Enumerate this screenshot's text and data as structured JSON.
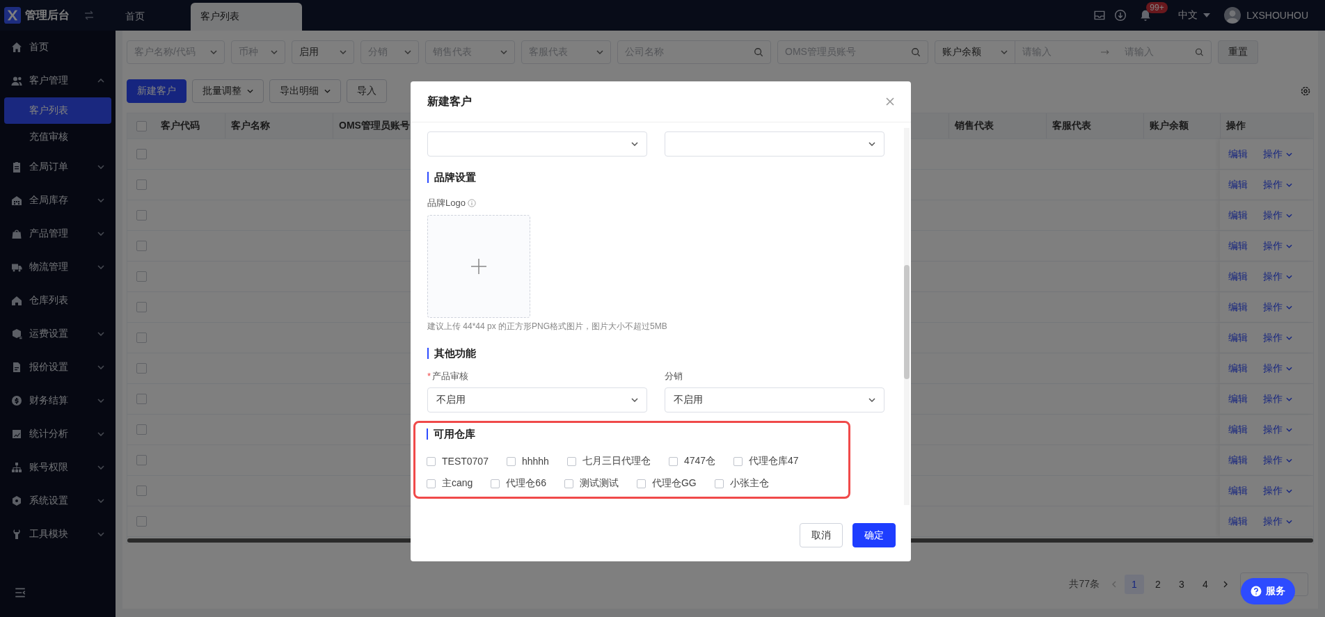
{
  "app": {
    "title": "管理后台"
  },
  "tabs": [
    {
      "label": "首页",
      "selected": false
    },
    {
      "label": "客户列表",
      "selected": true
    }
  ],
  "header": {
    "badge": "99+",
    "language": "中文",
    "user": "LXSHOUHOU"
  },
  "sidebar": {
    "items": [
      {
        "label": "首页"
      },
      {
        "label": "客户管理",
        "expanded": true,
        "children": [
          {
            "label": "客户列表",
            "selected": true
          },
          {
            "label": "充值审核",
            "selected": false
          }
        ]
      },
      {
        "label": "全局订单",
        "expanded": false
      },
      {
        "label": "全局库存",
        "expanded": false
      },
      {
        "label": "产品管理",
        "expanded": false
      },
      {
        "label": "物流管理",
        "expanded": false
      },
      {
        "label": "仓库列表"
      },
      {
        "label": "运费设置",
        "expanded": false
      },
      {
        "label": "报价设置",
        "expanded": false
      },
      {
        "label": "财务结算",
        "expanded": false
      },
      {
        "label": "统计分析",
        "expanded": false
      },
      {
        "label": "账号权限",
        "expanded": false
      },
      {
        "label": "系统设置",
        "expanded": false
      },
      {
        "label": "工具模块",
        "expanded": false
      }
    ]
  },
  "filters": [
    {
      "kind": "select",
      "placeholder": "客户名称/代码"
    },
    {
      "kind": "select",
      "placeholder": "币种"
    },
    {
      "kind": "select",
      "value": "启用"
    },
    {
      "kind": "select",
      "placeholder": "分销"
    },
    {
      "kind": "select",
      "placeholder": "销售代表"
    },
    {
      "kind": "select",
      "placeholder": "客服代表"
    },
    {
      "kind": "search",
      "placeholder": "公司名称"
    },
    {
      "kind": "search",
      "placeholder": "OMS管理员账号"
    },
    {
      "kind": "range",
      "value": "账户余额",
      "from_placeholder": "请输入",
      "to_placeholder": "请输入"
    }
  ],
  "reset_button": "重置",
  "toolbar": [
    {
      "label": "新建客户",
      "kind": "primary"
    },
    {
      "label": "批量调整",
      "kind": "dropdown"
    },
    {
      "label": "导出明细",
      "kind": "dropdown"
    },
    {
      "label": "导入",
      "kind": "plain"
    }
  ],
  "table": {
    "columns_left": [
      "客户代码",
      "客户名称",
      "OMS管理员账号"
    ],
    "columns_right": [
      "销售代表",
      "客服代表",
      "账户余额",
      "操作"
    ],
    "all_checked": false,
    "rows": [
      {
        "checked": false,
        "edit": "编辑",
        "more": "操作"
      },
      {
        "checked": false,
        "edit": "编辑",
        "more": "操作"
      },
      {
        "checked": false,
        "edit": "编辑",
        "more": "操作"
      },
      {
        "checked": false,
        "edit": "编辑",
        "more": "操作"
      },
      {
        "checked": false,
        "edit": "编辑",
        "more": "操作"
      },
      {
        "checked": false,
        "edit": "编辑",
        "more": "操作"
      },
      {
        "checked": false,
        "edit": "编辑",
        "more": "操作"
      },
      {
        "checked": false,
        "edit": "编辑",
        "more": "操作"
      },
      {
        "checked": false,
        "edit": "编辑",
        "more": "操作"
      },
      {
        "checked": false,
        "edit": "编辑",
        "more": "操作"
      },
      {
        "checked": false,
        "edit": "编辑",
        "more": "操作"
      },
      {
        "checked": false,
        "edit": "编辑",
        "more": "操作"
      },
      {
        "checked": false,
        "edit": "编辑",
        "more": "操作"
      }
    ]
  },
  "pagination": {
    "total": "共77条",
    "pages": [
      {
        "label": "1",
        "selected": true
      },
      {
        "label": "2",
        "selected": false
      },
      {
        "label": "3",
        "selected": false
      },
      {
        "label": "4",
        "selected": false
      }
    ]
  },
  "service_button": "服务",
  "modal": {
    "title": "新建客户",
    "top_fields": [
      {
        "kind": "select"
      },
      {
        "kind": "select"
      }
    ],
    "sections": [
      {
        "kind": "upload",
        "title": "品牌设置",
        "label": "品牌Logo",
        "hint": "建议上传 44*44 px 的正方形PNG格式图片，图片大小不超过5MB"
      },
      {
        "kind": "fields",
        "title": "其他功能",
        "fields": [
          {
            "label": "产品审核",
            "required_mark": "*",
            "value": "不启用"
          },
          {
            "label": "分销",
            "value": "不启用"
          }
        ]
      },
      {
        "kind": "checkboxes",
        "title": "可用仓库",
        "highlighted": true,
        "options": [
          {
            "label": "TEST0707",
            "checked": false
          },
          {
            "label": "hhhhh",
            "checked": false
          },
          {
            "label": "七月三日代理仓",
            "checked": false
          },
          {
            "label": "4747仓",
            "checked": false
          },
          {
            "label": "代理仓库47",
            "checked": false
          },
          {
            "label": "主cang",
            "checked": false
          },
          {
            "label": "代理仓66",
            "checked": false
          },
          {
            "label": "测试测试",
            "checked": false
          },
          {
            "label": "代理仓GG",
            "checked": false
          },
          {
            "label": "小张主仓",
            "checked": false
          }
        ]
      }
    ],
    "buttons": [
      {
        "label": "取消",
        "kind": "default"
      },
      {
        "label": "确定",
        "kind": "primary"
      }
    ]
  }
}
